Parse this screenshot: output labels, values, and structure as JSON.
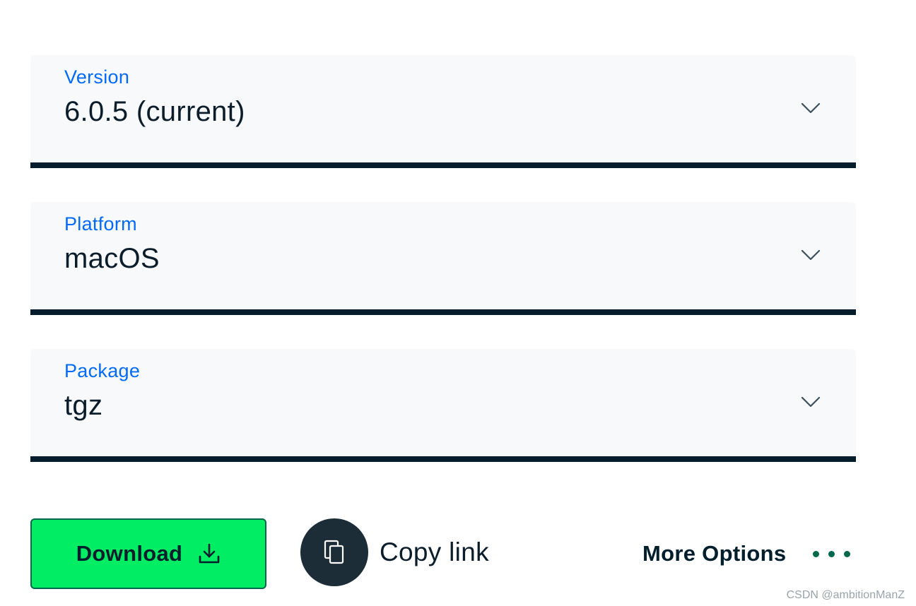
{
  "selects": {
    "version": {
      "label": "Version",
      "value": "6.0.5 (current)"
    },
    "platform": {
      "label": "Platform",
      "value": "macOS"
    },
    "package": {
      "label": "Package",
      "value": "tgz"
    }
  },
  "actions": {
    "download_label": "Download",
    "copy_label": "Copy link",
    "more_label": "More Options"
  },
  "watermark": "CSDN @ambitionManZ",
  "icons": {
    "select_chevron": "chevron-down-icon",
    "download": "download-icon",
    "copy": "copy-icon",
    "more": "ellipsis-icon"
  },
  "colors": {
    "label_blue": "#016bf8",
    "primary_green": "#00ed64",
    "dark_green": "#00684a",
    "navy": "#041c2c"
  }
}
